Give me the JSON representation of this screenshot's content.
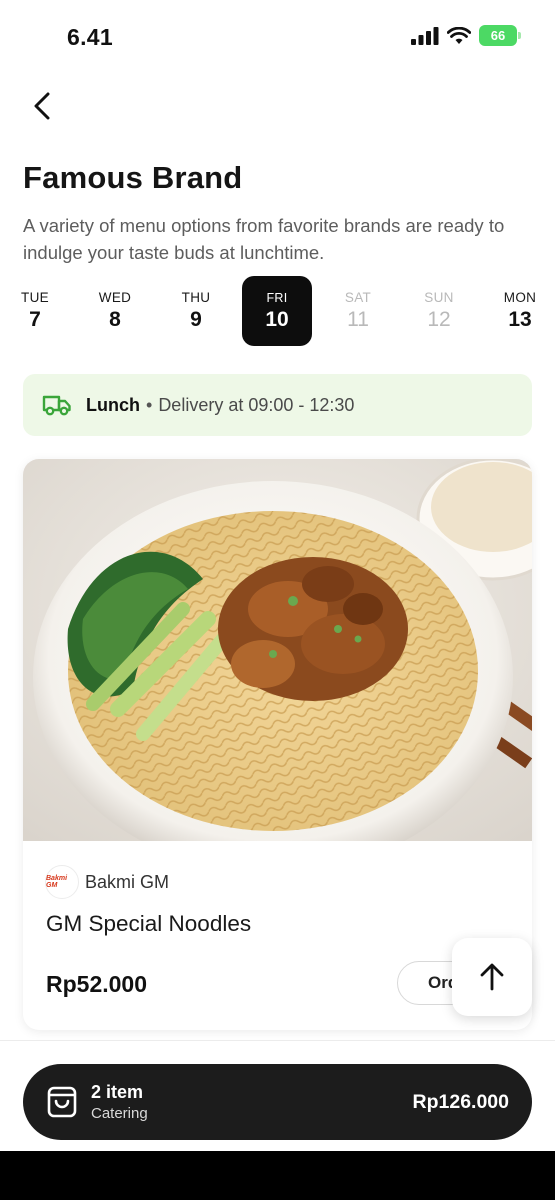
{
  "status_bar": {
    "time": "6.41",
    "battery": "66"
  },
  "header": {
    "title": "Famous Brand",
    "subtitle": "A variety of menu options from favorite brands are ready to indulge your taste buds at lunchtime."
  },
  "days": [
    {
      "name": "TUE",
      "num": "7",
      "state": "normal"
    },
    {
      "name": "WED",
      "num": "8",
      "state": "normal"
    },
    {
      "name": "THU",
      "num": "9",
      "state": "normal"
    },
    {
      "name": "FRI",
      "num": "10",
      "state": "selected"
    },
    {
      "name": "SAT",
      "num": "11",
      "state": "disabled"
    },
    {
      "name": "SUN",
      "num": "12",
      "state": "disabled"
    },
    {
      "name": "MON",
      "num": "13",
      "state": "normal"
    }
  ],
  "delivery": {
    "meal": "Lunch",
    "separator": "•",
    "window": "Delivery at 09:00 - 12:30"
  },
  "product": {
    "brand_logo_text": "Bakmi GM",
    "brand": "Bakmi GM",
    "name": "GM Special Noodles",
    "price": "Rp52.000",
    "order_label": "Order"
  },
  "cart": {
    "count": "2 item",
    "label": "Catering",
    "total": "Rp126.000"
  },
  "colors": {
    "accent_dark": "#0d0d0d",
    "banner_bg": "#eef8e7",
    "delivery_icon": "#3aa53a",
    "battery": "#4cd964"
  },
  "icons": [
    "back-icon",
    "signal-icon",
    "wifi-icon",
    "battery-icon",
    "delivery-truck-icon",
    "arrow-up-icon",
    "shopping-bag-icon"
  ]
}
